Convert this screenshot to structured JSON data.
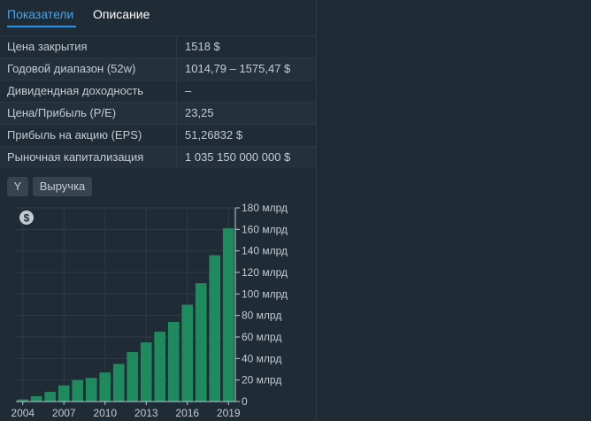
{
  "tabs": {
    "indicators": "Показатели",
    "description": "Описание"
  },
  "table": {
    "rows": [
      {
        "label": "Цена закрытия",
        "value": "1518 $"
      },
      {
        "label": "Годовой диапазон (52w)",
        "value": "1014,79 – 1575,47 $"
      },
      {
        "label": "Дивидендная доходность",
        "value": "–"
      },
      {
        "label": "Цена/Прибыль (P/E)",
        "value": "23,25"
      },
      {
        "label": "Прибыль на акцию (EPS)",
        "value": "51,26832 $"
      },
      {
        "label": "Рыночная капитализация",
        "value": "1 035 150 000 000 $"
      }
    ]
  },
  "buttons": {
    "year": "Y",
    "revenue": "Выручка"
  },
  "currency_badge": "$",
  "colors": {
    "bar": "#1e8a5e",
    "accent": "#2f8fe0"
  },
  "chart_data": {
    "type": "bar",
    "categories": [
      "2004",
      "2005",
      "2006",
      "2007",
      "2008",
      "2009",
      "2010",
      "2011",
      "2012",
      "2013",
      "2014",
      "2015",
      "2016",
      "2017",
      "2018",
      "2019"
    ],
    "values": [
      2,
      5,
      9,
      15,
      20,
      22,
      27,
      35,
      46,
      55,
      65,
      74,
      90,
      110,
      136,
      161
    ],
    "x_tick_labels": [
      "2004",
      "2007",
      "2010",
      "2013",
      "2016",
      "2019"
    ],
    "y_ticks": [
      "0",
      "20 млрд",
      "40 млрд",
      "60 млрд",
      "80 млрд",
      "100 млрд",
      "120 млрд",
      "140 млрд",
      "160 млрд",
      "180 млрд"
    ],
    "ylim": [
      0,
      180
    ],
    "grid": true
  }
}
